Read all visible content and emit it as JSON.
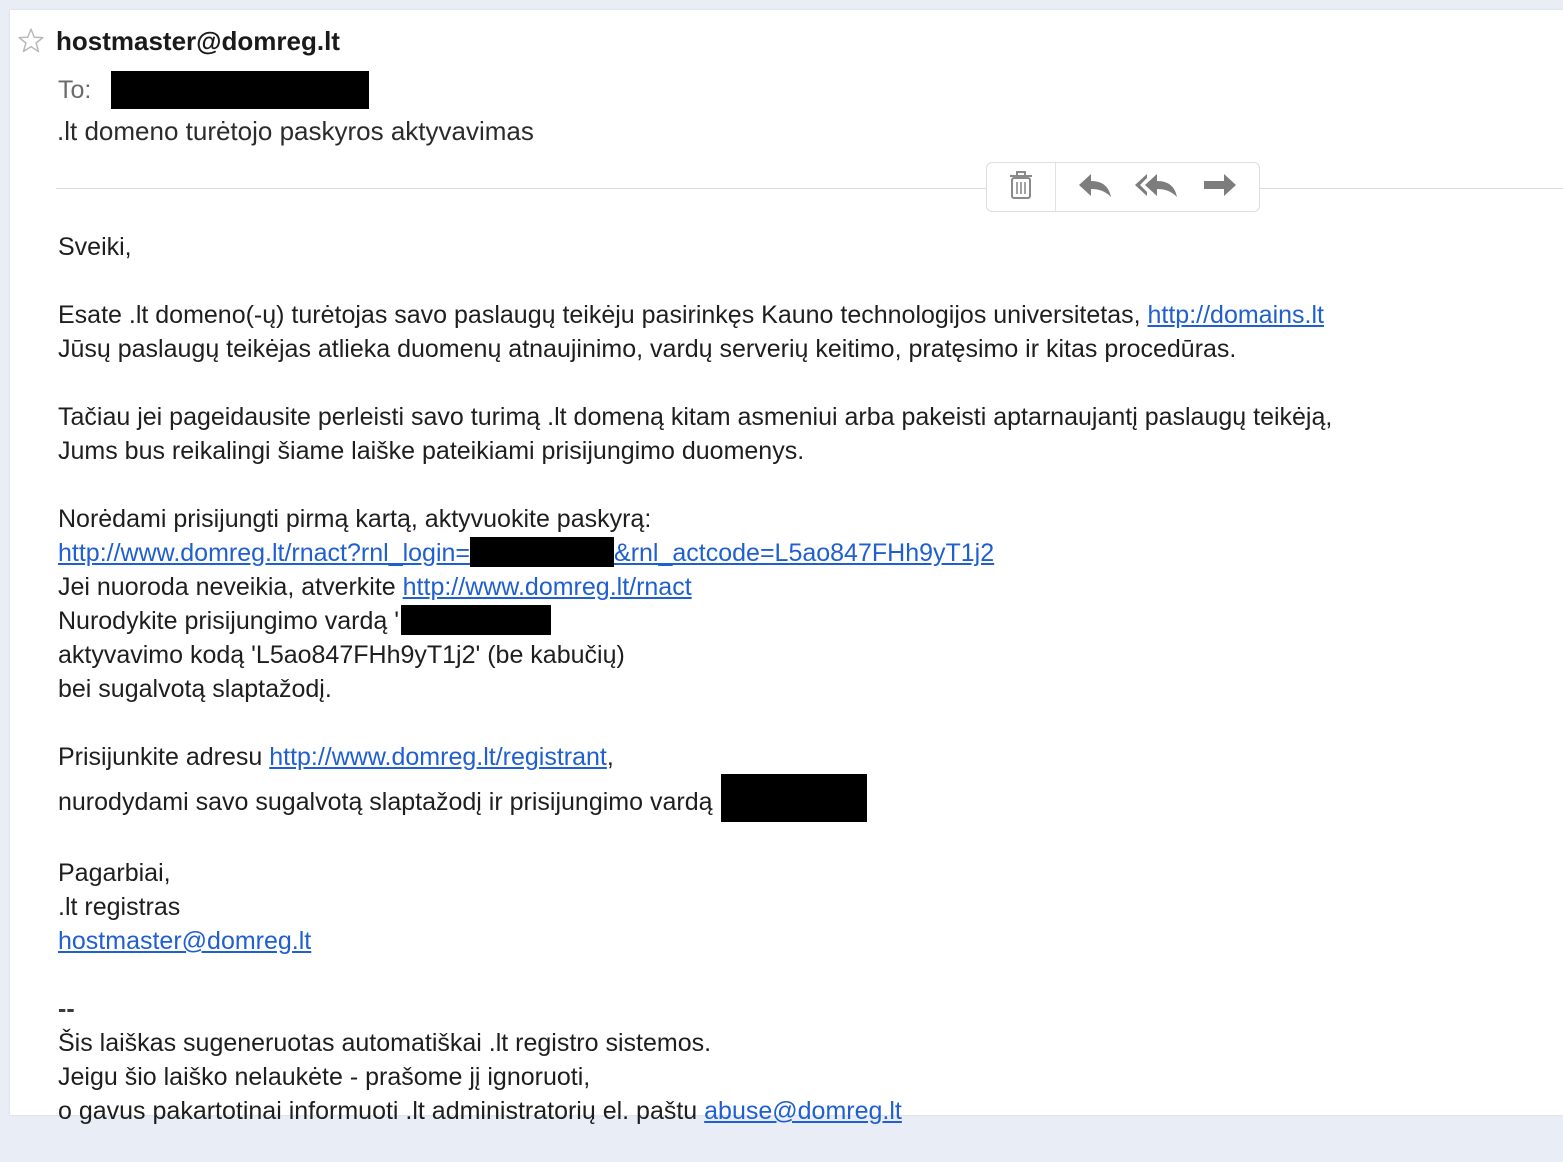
{
  "colors": {
    "link": "#1f5fd1",
    "text": "#1e1e1e",
    "muted": "#6b6b6b",
    "background": "#e9eef6",
    "redaction": "#000000"
  },
  "header": {
    "star_icon": "star-outline-icon",
    "sender": "hostmaster@domreg.lt",
    "to_label": "To:",
    "subject": ".lt domeno turėtojo paskyros aktyvavimas"
  },
  "toolbar": {
    "icons": [
      "trash-icon",
      "reply-icon",
      "reply-all-icon",
      "forward-icon"
    ]
  },
  "body": {
    "greeting": "Sveiki,",
    "para1": {
      "line1_text": "Esate .lt domeno(-ų) turėtojas savo paslaugų teikėju pasirinkęs Kauno technologijos universitetas, ",
      "line1_link": "http://domains.lt",
      "line2": "Jūsų paslaugų teikėjas atlieka duomenų atnaujinimo, vardų serverių keitimo, pratęsimo ir kitas procedūras."
    },
    "para2": {
      "line1": "Tačiau jei pageidausite perleisti savo turimą .lt domeną kitam asmeniui arba pakeisti aptarnaujantį paslaugų teikėją,",
      "line2": "Jums bus reikalingi šiame laiške pateikiami prisijungimo duomenys."
    },
    "para3": {
      "line1": "Norėdami prisijungti pirmą kartą, aktyvuokite paskyrą:",
      "activation_link_part1": "http://www.domreg.lt/rnact?rnl_login=",
      "activation_link_part2": "&rnl_actcode=L5ao847FHh9yT1j2",
      "line3_text": "Jei nuoroda neveikia, atverkite ",
      "line3_link": "http://www.domreg.lt/rnact",
      "line4_text": "Nurodykite prisijungimo vardą '",
      "line5": "aktyvavimo kodą 'L5ao847FHh9yT1j2' (be kabučių)",
      "line6": "bei sugalvotą slaptažodį."
    },
    "para4": {
      "line1_text": "Prisijunkite adresu ",
      "line1_link": "http://www.domreg.lt/registrant",
      "line1_suffix": ",",
      "line2_text": "nurodydami savo sugalvotą slaptažodį ir prisijungimo vardą"
    },
    "signature": {
      "line1": "Pagarbiai,",
      "line2": ".lt registras",
      "email": "hostmaster@domreg.lt"
    },
    "footer": {
      "dash": "--",
      "line1": "Šis laiškas sugeneruotas automatiškai .lt registro sistemos.",
      "line2": "Jeigu šio laiško nelaukėte - prašome jį ignoruoti,",
      "line3_text": "o gavus pakartotinai informuoti .lt administratorių el. paštu ",
      "line3_link": "abuse@domreg.lt"
    }
  }
}
